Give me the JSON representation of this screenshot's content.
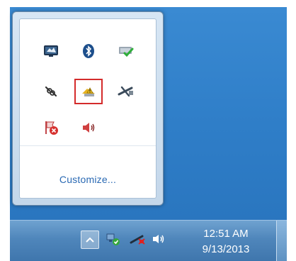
{
  "notification_area": {
    "customize_label": "Customize..."
  },
  "clock": {
    "time": "12:51 AM",
    "date": "9/13/2013"
  },
  "icons": {
    "row1": [
      "display-icon",
      "bluetooth-icon",
      "network-check-icon"
    ],
    "row2": [
      "connection-icon",
      "wireless-warning-icon",
      "network-disabled-icon"
    ],
    "row3": [
      "action-center-icon",
      "volume-icon"
    ],
    "taskbar": [
      "show-hidden-icons-button",
      "network-status-icon",
      "network-disabled-tray-icon",
      "volume-tray-icon"
    ]
  },
  "colors": {
    "desktop_blue": "#2f7ec8",
    "selection_red": "#d42b2b",
    "link_blue": "#2a69b3"
  }
}
